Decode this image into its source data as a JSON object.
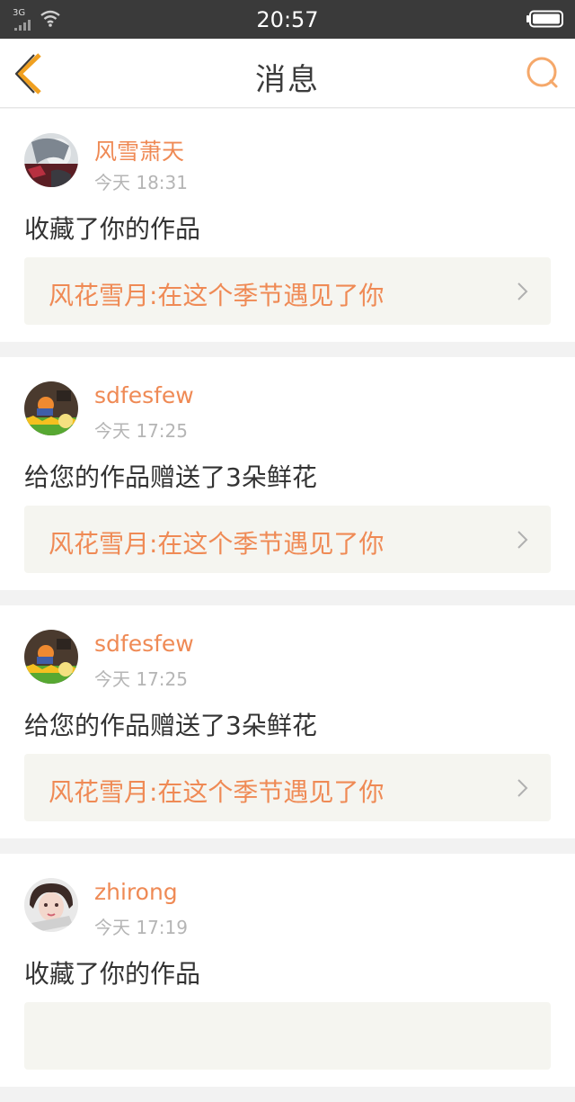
{
  "status_bar": {
    "network": "3G",
    "time": "20:57"
  },
  "header": {
    "title": "消息"
  },
  "messages": [
    {
      "username": "风雪萧天",
      "time": "今天 18:31",
      "action": "收藏了你的作品",
      "work": "风花雪月:在这个季节遇见了你",
      "avatar": "avatar-snow-girl"
    },
    {
      "username": "sdfesfew",
      "time": "今天 17:25",
      "action": "给您的作品赠送了3朵鲜花",
      "work": "风花雪月:在这个季节遇见了你",
      "avatar": "avatar-cartoon"
    },
    {
      "username": "sdfesfew",
      "time": "今天 17:25",
      "action": "给您的作品赠送了3朵鲜花",
      "work": "风花雪月:在这个季节遇见了你",
      "avatar": "avatar-cartoon"
    },
    {
      "username": "zhirong",
      "time": "今天 17:19",
      "action": "收藏了你的作品",
      "work": "",
      "avatar": "avatar-girl"
    }
  ],
  "colors": {
    "accent": "#ef8a55",
    "status_bar": "#3a3a3a",
    "card_link_bg": "#f5f5f0"
  }
}
